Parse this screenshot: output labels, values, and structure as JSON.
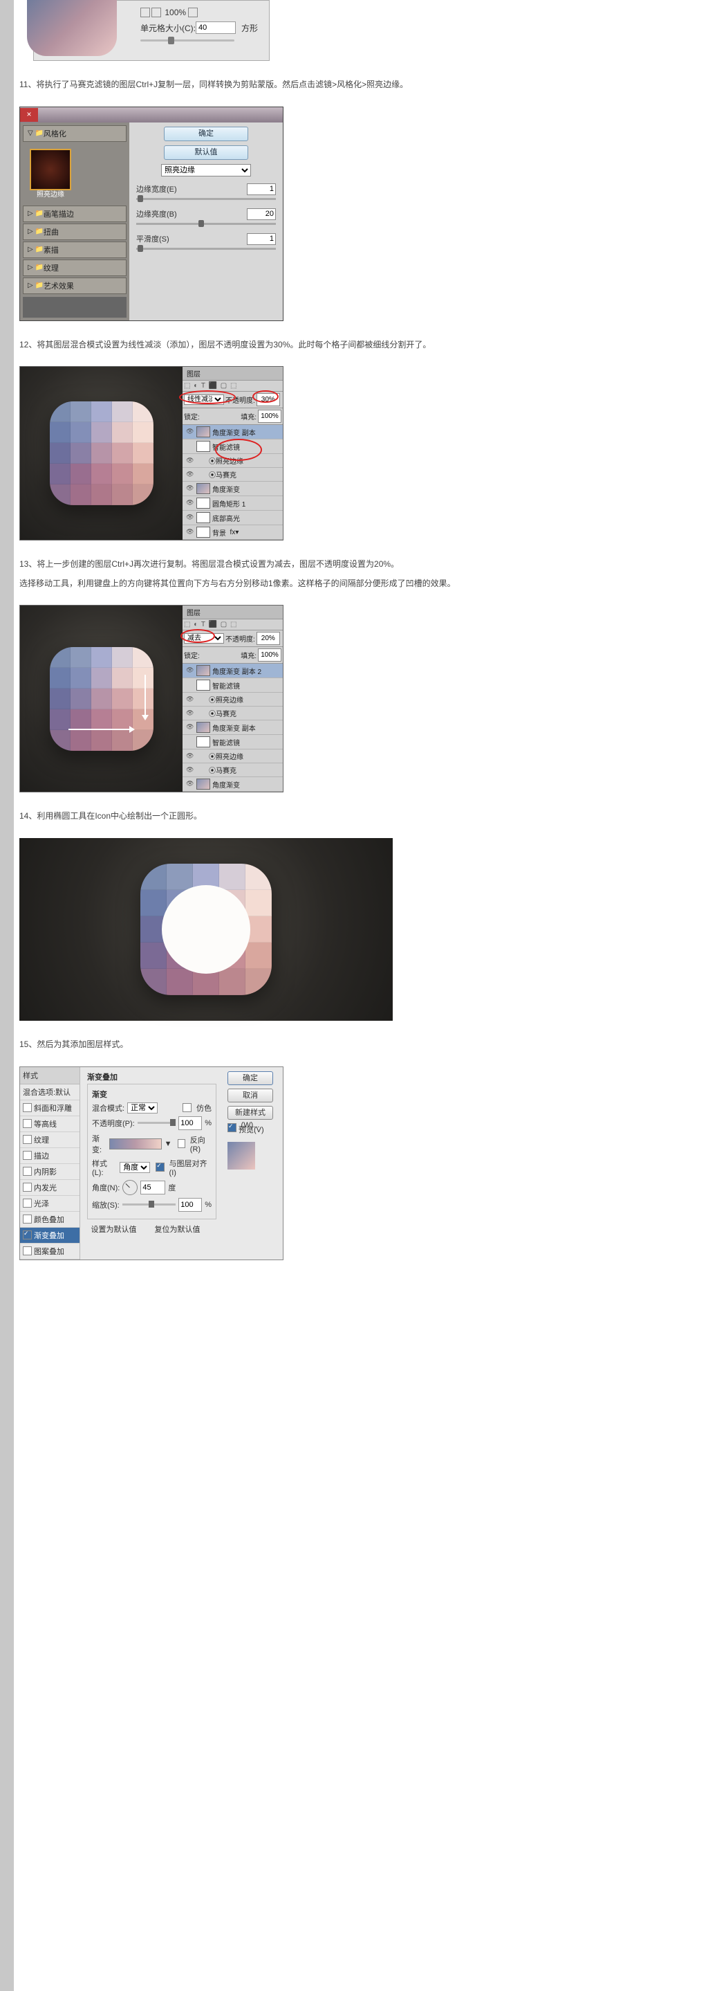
{
  "top": {
    "zoom": "100%",
    "cell_label": "单元格大小(C):",
    "cell_value": "40",
    "cell_unit": "方形"
  },
  "step11": "11、将执行了马赛克滤镜的图层Ctrl+J复制一层，同样转换为剪贴蒙版。然后点击滤镜>风格化>照亮边缘。",
  "filter": {
    "title": "风格化",
    "ok": "确定",
    "cancel": "默认值",
    "select": "照亮边缘",
    "thumb_label": "照亮边缘",
    "folders": [
      "画笔描边",
      "扭曲",
      "素描",
      "纹理",
      "艺术效果"
    ],
    "p1": {
      "label": "边缘宽度(E)",
      "val": "1"
    },
    "p2": {
      "label": "边缘亮度(B)",
      "val": "20"
    },
    "p3": {
      "label": "平滑度(S)",
      "val": "1"
    }
  },
  "step12": "12、将其图层混合模式设置为线性减淡（添加），图层不透明度设置为30%。此时每个格子间都被细线分割开了。",
  "panel12": {
    "tab": "图层",
    "row2": "锁定:",
    "fill": "填充:",
    "fillv": "100%",
    "mode_label": "线性减淡 (添",
    "op_label": "不透明度:",
    "op": "30%",
    "layers": [
      "角度渐变 副本",
      "智能滤镜",
      "照亮边缘",
      "马赛克",
      "角度渐变",
      "圆角矩形 1",
      "底部高光",
      "背景"
    ]
  },
  "step13a": "13、将上一步创建的图层Ctrl+J再次进行复制。将图层混合模式设置为减去，图层不透明度设置为20%。",
  "step13b": "选择移动工具，利用键盘上的方向键将其位置向下方与右方分别移动1像素。这样格子的间隔部分便形成了凹槽的效果。",
  "panel13": {
    "mode_label": "减去",
    "op": "20%",
    "fillv": "100%",
    "layers": [
      "角度渐变 副本 2",
      "智能滤镜",
      "照亮边缘",
      "马赛克",
      "角度渐变 副本",
      "智能滤镜",
      "照亮边缘",
      "马赛克",
      "角度渐变"
    ]
  },
  "step14": "14、利用椭圆工具在Icon中心绘制出一个正圆形。",
  "step15": "15、然后为其添加图层样式。",
  "ls": {
    "styles_hd": "样式",
    "blend_hd": "混合选项:默认",
    "items": [
      "斜面和浮雕",
      "等高线",
      "纹理",
      "描边",
      "内阴影",
      "内发光",
      "光泽",
      "颜色叠加",
      "渐变叠加",
      "图案叠加"
    ],
    "section": "渐变叠加",
    "sub": "渐变",
    "blend_mode_lbl": "混合模式:",
    "blend_mode": "正常",
    "dither": "仿色",
    "opacity_lbl": "不透明度(P):",
    "opacity": "100",
    "grad_lbl": "渐变:",
    "reverse": "反向(R)",
    "style_lbl": "样式(L):",
    "style": "角度",
    "align": "与图层对齐(I)",
    "angle_lbl": "角度(N):",
    "angle": "45",
    "deg": "度",
    "scale_lbl": "缩放(S):",
    "scale": "100",
    "pct": "%",
    "btn_def": "设置为默认值",
    "btn_reset": "复位为默认值",
    "ok": "确定",
    "cancel": "取消",
    "new": "新建样式(W)...",
    "preview": "预览(V)"
  }
}
